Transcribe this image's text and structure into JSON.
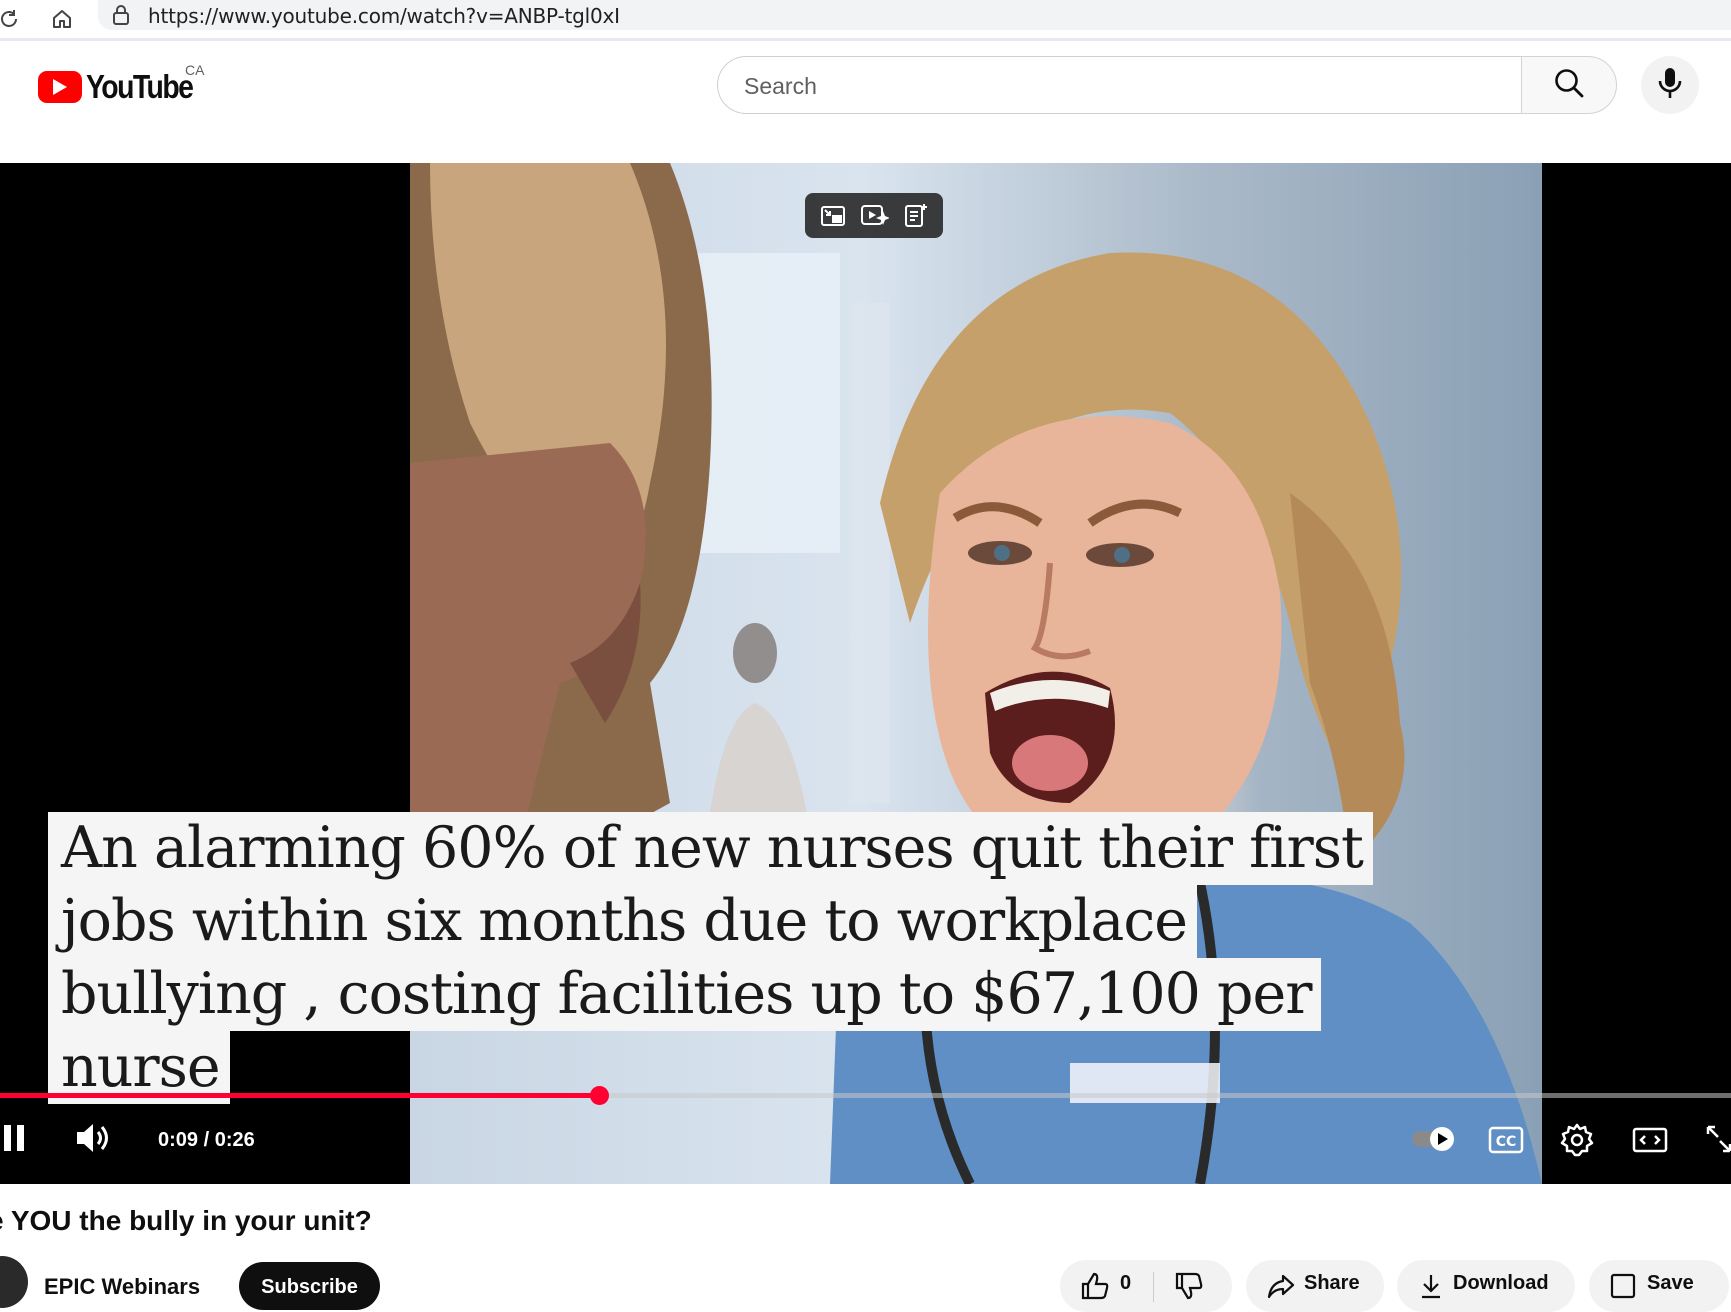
{
  "browser": {
    "url": "https://www.youtube.com/watch?v=ANBP-tgl0xI"
  },
  "masthead": {
    "logo_text": "YouTube",
    "region": "CA",
    "search_placeholder": "Search"
  },
  "player": {
    "caption_lines": [
      "An alarming 60% of new nurses quit their first",
      "jobs within six months due to workplace",
      "bullying , costing facilities up to $67,100 per",
      "nurse"
    ],
    "time_display": "0:09 / 0:26",
    "progress_fraction": 0.346
  },
  "video": {
    "title": "e YOU the bully in your unit?",
    "channel": "EPIC Webinars",
    "subscribe_label": "Subscribe",
    "like_count": "0",
    "share_label": "Share",
    "download_label": "Download",
    "save_label": "Save"
  },
  "colors": {
    "youtube_red": "#ff0000",
    "progress_red": "#ff0033"
  }
}
